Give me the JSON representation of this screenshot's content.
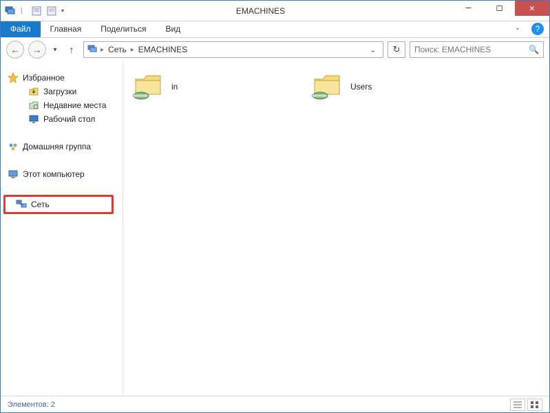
{
  "window": {
    "title": "EMACHINES"
  },
  "ribbon": {
    "file": "Файл",
    "tabs": [
      "Главная",
      "Поделиться",
      "Вид"
    ]
  },
  "address": {
    "crumb1": "Сеть",
    "crumb2": "EMACHINES"
  },
  "search": {
    "placeholder": "Поиск: EMACHINES"
  },
  "sidebar": {
    "favorites": "Избранное",
    "downloads": "Загрузки",
    "recent": "Недавние места",
    "desktop": "Рабочий стол",
    "homegroup": "Домашняя группа",
    "computer": "Этот компьютер",
    "network": "Сеть"
  },
  "items": [
    {
      "name": "in"
    },
    {
      "name": "Users"
    }
  ],
  "status": {
    "count_label": "Элементов: 2"
  }
}
